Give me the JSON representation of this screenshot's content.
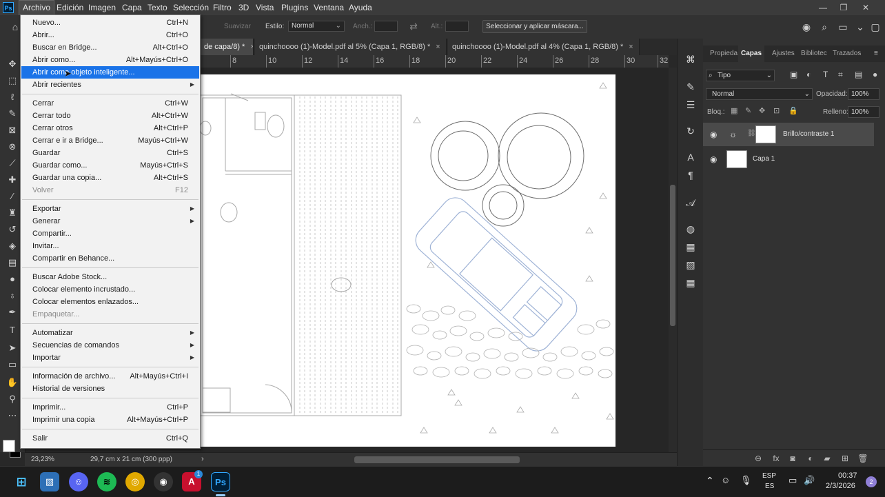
{
  "app": {
    "logo": "Ps"
  },
  "menubar": {
    "items": [
      "Archivo",
      "Edición",
      "Imagen",
      "Capa",
      "Texto",
      "Selección",
      "Filtro",
      "3D",
      "Vista",
      "Plugins",
      "Ventana",
      "Ayuda"
    ],
    "active": "Archivo"
  },
  "window_controls": {
    "minimize": "—",
    "restore": "❐",
    "close": "✕"
  },
  "options_bar": {
    "smooth_label": "Suavizar",
    "style_label": "Estilo:",
    "style_value": "Normal",
    "width_label": "Anch.:",
    "height_label": "Alt.:",
    "select_mask_button": "Seleccionar y aplicar máscara..."
  },
  "tabs": [
    {
      "label": "de capa/8) *",
      "active": true
    },
    {
      "label": "quinchoooo (1)-Model.pdf al 5% (Capa 1, RGB/8) *",
      "active": false
    },
    {
      "label": "quinchoooo (1)-Model.pdf al 4% (Capa 1, RGB/8) *",
      "active": false
    }
  ],
  "tab_close": "×",
  "ruler": {
    "ticks": [
      "8",
      "10",
      "12",
      "14",
      "16",
      "18",
      "20",
      "22",
      "24",
      "26",
      "28",
      "30",
      "32"
    ]
  },
  "status_bar": {
    "zoom": "23,23%",
    "doc_size": "29,7 cm x 21 cm (300 ppp)",
    "arrow": "›"
  },
  "file_menu": {
    "groups": [
      [
        {
          "label": "Nuevo...",
          "shortcut": "Ctrl+N"
        },
        {
          "label": "Abrir...",
          "shortcut": "Ctrl+O"
        },
        {
          "label": "Buscar en Bridge...",
          "shortcut": "Alt+Ctrl+O"
        },
        {
          "label": "Abrir como...",
          "shortcut": "Alt+Mayús+Ctrl+O"
        },
        {
          "label": "Abrir como objeto inteligente...",
          "shortcut": "",
          "highlighted": true
        },
        {
          "label": "Abrir recientes",
          "shortcut": "",
          "submenu": true
        }
      ],
      [
        {
          "label": "Cerrar",
          "shortcut": "Ctrl+W"
        },
        {
          "label": "Cerrar todo",
          "shortcut": "Alt+Ctrl+W"
        },
        {
          "label": "Cerrar otros",
          "shortcut": "Alt+Ctrl+P"
        },
        {
          "label": "Cerrar e ir a Bridge...",
          "shortcut": "Mayús+Ctrl+W"
        },
        {
          "label": "Guardar",
          "shortcut": "Ctrl+S"
        },
        {
          "label": "Guardar como...",
          "shortcut": "Mayús+Ctrl+S"
        },
        {
          "label": "Guardar una copia...",
          "shortcut": "Alt+Ctrl+S"
        },
        {
          "label": "Volver",
          "shortcut": "F12",
          "disabled": true
        }
      ],
      [
        {
          "label": "Exportar",
          "shortcut": "",
          "submenu": true
        },
        {
          "label": "Generar",
          "shortcut": "",
          "submenu": true
        },
        {
          "label": "Compartir...",
          "shortcut": ""
        },
        {
          "label": "Invitar...",
          "shortcut": ""
        },
        {
          "label": "Compartir en Behance...",
          "shortcut": ""
        }
      ],
      [
        {
          "label": "Buscar Adobe Stock...",
          "shortcut": ""
        },
        {
          "label": "Colocar elemento incrustado...",
          "shortcut": ""
        },
        {
          "label": "Colocar elementos enlazados...",
          "shortcut": ""
        },
        {
          "label": "Empaquetar...",
          "shortcut": "",
          "disabled": true
        }
      ],
      [
        {
          "label": "Automatizar",
          "shortcut": "",
          "submenu": true
        },
        {
          "label": "Secuencias de comandos",
          "shortcut": "",
          "submenu": true
        },
        {
          "label": "Importar",
          "shortcut": "",
          "submenu": true
        }
      ],
      [
        {
          "label": "Información de archivo...",
          "shortcut": "Alt+Mayús+Ctrl+I"
        },
        {
          "label": "Historial de versiones",
          "shortcut": ""
        }
      ],
      [
        {
          "label": "Imprimir...",
          "shortcut": "Ctrl+P"
        },
        {
          "label": "Imprimir una copia",
          "shortcut": "Alt+Mayús+Ctrl+P"
        }
      ],
      [
        {
          "label": "Salir",
          "shortcut": "Ctrl+Q"
        }
      ]
    ]
  },
  "layers_panel": {
    "tabs": [
      "Propieda",
      "Capas",
      "Ajustes",
      "Bibliotec",
      "Trazados"
    ],
    "active_tab": "Capas",
    "filter_value": "Tipo",
    "blend_mode": "Normal",
    "opacity_label": "Opacidad:",
    "opacity_value": "100%",
    "lock_label": "Bloq.:",
    "fill_label": "Relleno:",
    "fill_value": "100%",
    "layers": [
      {
        "name": "Brillo/contraste 1",
        "selected": true,
        "type": "adjustment"
      },
      {
        "name": "Capa 1",
        "selected": false,
        "type": "pixel"
      }
    ]
  },
  "taskbar": {
    "apps": [
      "windows-start",
      "photos",
      "discord",
      "spotify",
      "chrome",
      "obs",
      "autocad",
      "photoshop"
    ],
    "lang_top": "ESP",
    "lang_bottom": "ES",
    "time": "00:37",
    "date": "2/3/2026",
    "notifications": "2",
    "autocad_badge": "1"
  },
  "colors": {
    "accent": "#1a73e8",
    "ps_blue": "#31a8ff",
    "sketch": "#9aa5b8"
  }
}
